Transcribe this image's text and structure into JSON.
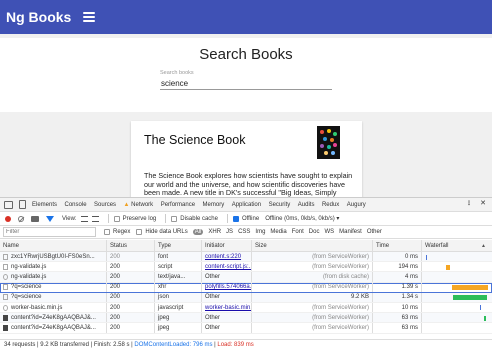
{
  "app": {
    "brand": "Ng Books",
    "search_title": "Search Books",
    "search_label": "Search books",
    "search_value": "science",
    "book": {
      "title": "The Science Book",
      "description": "The Science Book explores how scientists have sought to explain our world and the universe, and how scientific discoveries have been made. A new title in DK's successful \"Big Ideas, Simply Explained\" series, this book on science and"
    }
  },
  "devtools": {
    "tabs": [
      "Elements",
      "Console",
      "Sources",
      "Network",
      "Performance",
      "Memory",
      "Application",
      "Security",
      "Audits",
      "Redux",
      "Augury"
    ],
    "active_tab": "Network",
    "toolbar": {
      "view_label": "View:",
      "preserve_log": "Preserve log",
      "disable_cache": "Disable cache",
      "offline": "Offline",
      "throttle": "Offline (0ms, 0kb/s, 0kb/s) ▾"
    },
    "filter": {
      "placeholder": "Filter",
      "regex": "Regex",
      "hide_data_urls": "Hide data URLs",
      "types": [
        "All",
        "XHR",
        "JS",
        "CSS",
        "Img",
        "Media",
        "Font",
        "Doc",
        "WS",
        "Manifest",
        "Other"
      ]
    },
    "columns": {
      "name": "Name",
      "status": "Status",
      "type": "Type",
      "initiator": "Initiator",
      "size": "Size",
      "time": "Time",
      "waterfall": "Waterfall"
    },
    "rows": [
      {
        "name": "zxc1YRwrjUSBgtU0I-FS0eSn...",
        "status": "200",
        "type": "font",
        "initiator": "content.s:220",
        "size": "(from ServiceWorker)",
        "time": "0 ms"
      },
      {
        "name": "ng-validate.js",
        "status": "200",
        "type": "script",
        "initiator": "content-script.js:...",
        "size": "(from ServiceWorker)",
        "time": "194 ms"
      },
      {
        "name": "ng-validate.js",
        "status": "200",
        "type": "text/java...",
        "initiator": "Other",
        "size": "(from disk cache)",
        "time": "4 ms"
      },
      {
        "name": "?q=science",
        "status": "200",
        "type": "xhr",
        "initiator": "polyfills.574066a...",
        "size": "(from ServiceWorker)",
        "time": "1.39 s"
      },
      {
        "name": "?q=science",
        "status": "200",
        "type": "json",
        "initiator": "Other",
        "size": "9.2 KB",
        "time": "1.34 s"
      },
      {
        "name": "worker-basic.min.js",
        "status": "200",
        "type": "javascript",
        "initiator": "worker-basic.min.js",
        "size": "(from ServiceWorker)",
        "time": "10 ms"
      },
      {
        "name": "content?id=Z4eK8gAAQBAJ&...",
        "status": "200",
        "type": "jpeg",
        "initiator": "Other",
        "size": "(from ServiceWorker)",
        "time": "63 ms"
      },
      {
        "name": "content?id=Z4eK8gAAQBAJ&...",
        "status": "200",
        "type": "jpeg",
        "initiator": "Other",
        "size": "(from ServiceWorker)",
        "time": "63 ms"
      }
    ],
    "status_bar": {
      "summary": "34 requests | 9.2 KB transferred | Finish: 2.58 s |",
      "dom": "DOMContentLoaded: 796 ms",
      "sep": "|",
      "load": "Load: 839 ms"
    }
  }
}
